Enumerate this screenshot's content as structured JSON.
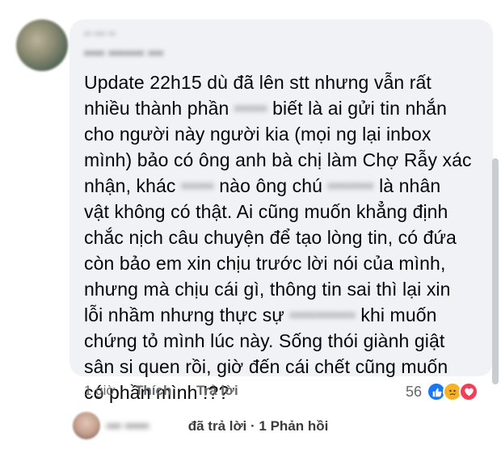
{
  "comment": {
    "meta_line": "•• ••• ••",
    "author_name": "•••• ••••••• •••",
    "lines": [
      [
        "Update 22h15 dù đã lên stt nhưng vẫn rất"
      ],
      [
        "nhiều thành phần ",
        {
          "blur": "•••••"
        },
        " biết là ai gửi tin nhắn"
      ],
      [
        "cho người này người kia (mọi ng lại inbox"
      ],
      [
        "mình) bảo có ông anh bà chị làm Chợ Rẫy xác"
      ],
      [
        "nhận, khác ",
        {
          "blur": "•••••"
        },
        " nào ông chú ",
        {
          "blur": "•••••••"
        },
        " là nhân"
      ],
      [
        "vật không có thật. Ai cũng muốn khẳng định"
      ],
      [
        "chắc nịch câu chuyện để tạo lòng tin, có đứa"
      ],
      [
        "còn bảo em xin chịu trước lời nói của mình,"
      ],
      [
        "nhưng mà chịu cái gì, thông tin sai thì lại xin"
      ],
      [
        "lỗi nhầm nhưng thực sự ",
        {
          "blur": "••••••••••"
        },
        " khi muốn"
      ],
      [
        "chứng tỏ mình lúc này. Sống thói giành giật"
      ],
      [
        "sân si quen rồi, giờ đến cái chết cũng muốn"
      ],
      [
        "có phần mình !??"
      ]
    ]
  },
  "actions": {
    "time": "1 giờ",
    "like_label": "Thích",
    "reply_label": "Trả lời"
  },
  "reactions": {
    "count": "56",
    "types": [
      "like-icon",
      "sad-icon",
      "love-icon"
    ]
  },
  "reply_summary": {
    "name": "••• •••••",
    "text": "đã trả lời · 1 Phản hồi"
  }
}
